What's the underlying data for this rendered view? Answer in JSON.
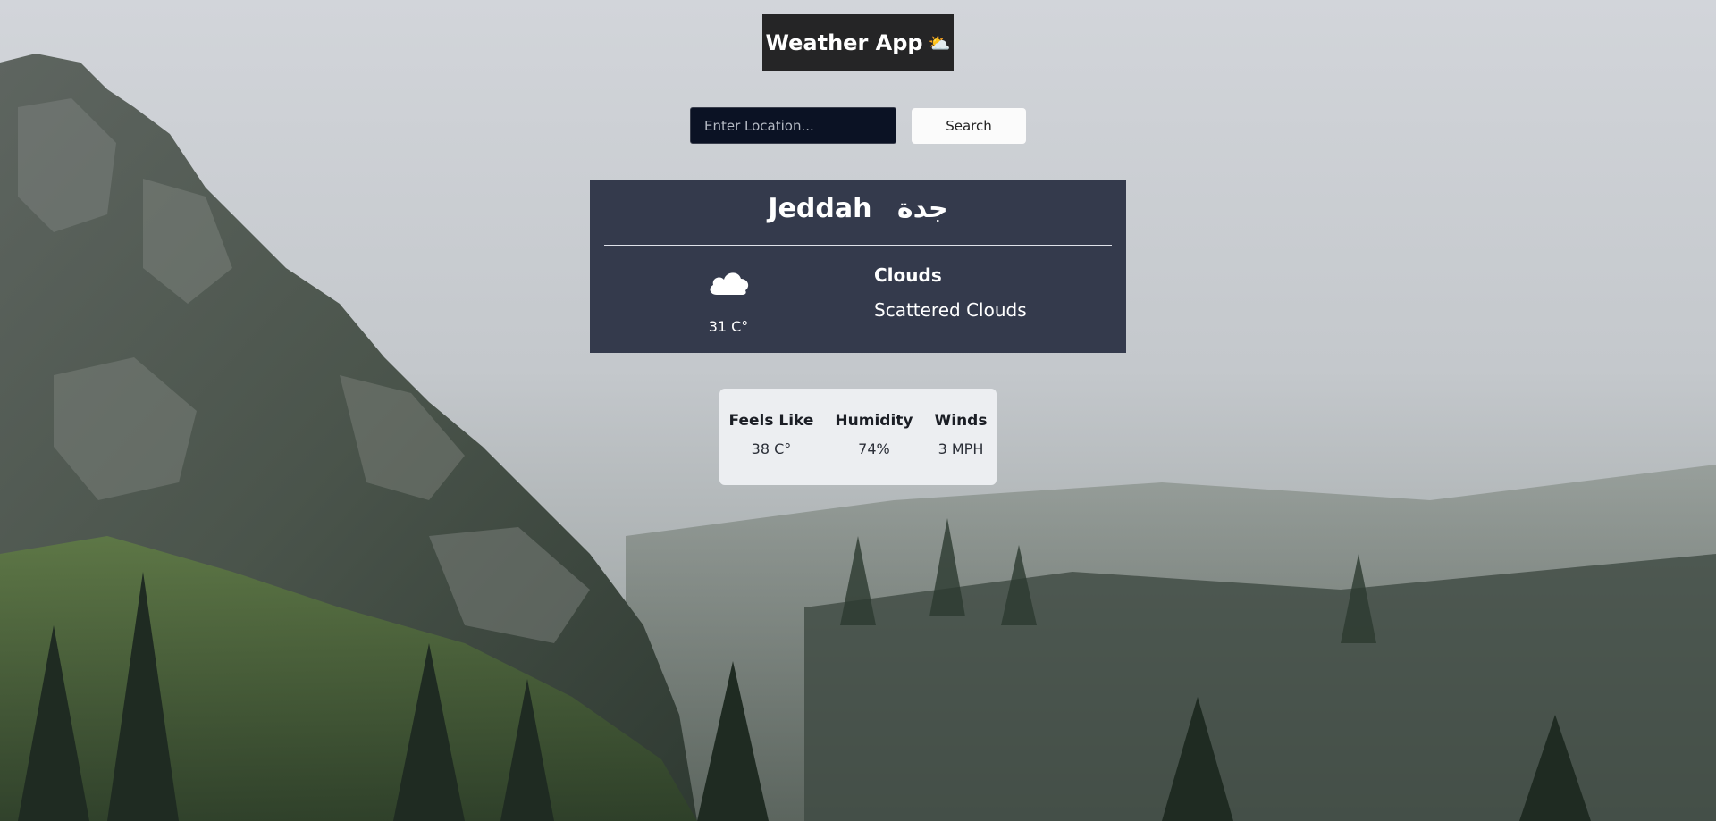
{
  "header": {
    "title": "Weather App",
    "title_icon": "⛅"
  },
  "search": {
    "placeholder": "Enter Location...",
    "value": "",
    "button_label": "Search"
  },
  "weather": {
    "city_en": "Jeddah",
    "city_ar": "جدة",
    "icon": "cloud-icon",
    "temperature": "31 C°",
    "condition_main": "Clouds",
    "condition_description": "Scattered Clouds"
  },
  "details": {
    "items": [
      {
        "label": "Feels Like",
        "value": "38 C°"
      },
      {
        "label": "Humidity",
        "value": "74%"
      },
      {
        "label": "Winds",
        "value": "3 MPH"
      }
    ]
  },
  "colors": {
    "title_bg": "#252526",
    "card_bg": "#343a4c",
    "input_bg": "#0b1224",
    "details_bg": "#eceef1"
  }
}
